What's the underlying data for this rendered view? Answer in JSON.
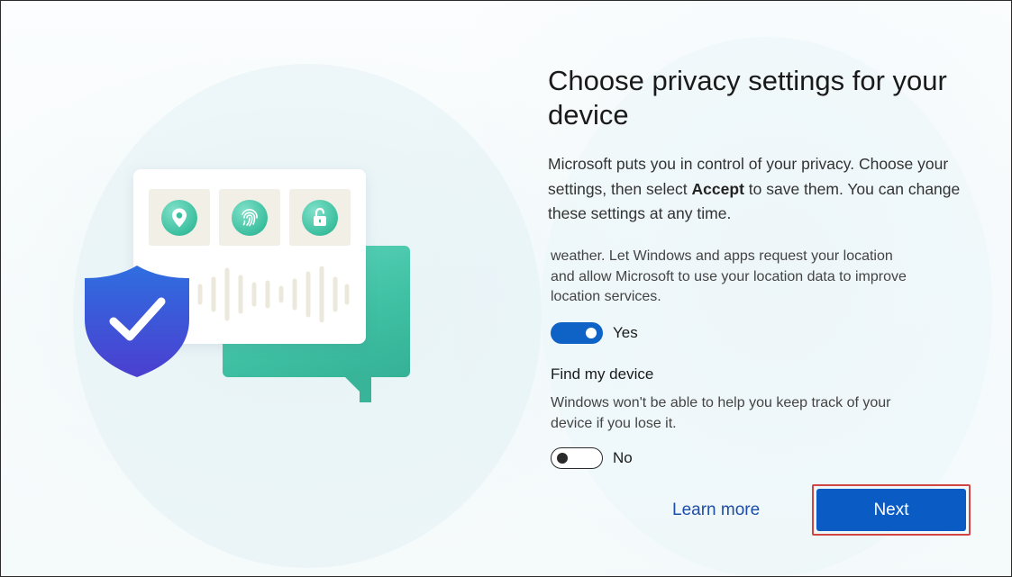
{
  "page": {
    "title": "Choose privacy settings for your device",
    "description_before": "Microsoft puts you in control of your privacy. Choose your settings, then select ",
    "description_bold": "Accept",
    "description_after": " to save them. You can change these settings at any time."
  },
  "settings": [
    {
      "title": "",
      "description": "weather. Let Windows and apps request your location and allow Microsoft to use your location data to improve location services.",
      "toggle_state": "on",
      "toggle_label": "Yes"
    },
    {
      "title": "Find my device",
      "description": "Windows won't be able to help you keep track of your device if you lose it.",
      "toggle_state": "off",
      "toggle_label": "No"
    }
  ],
  "actions": {
    "learn_more": "Learn more",
    "next": "Next"
  },
  "colors": {
    "accent": "#0a5bc4",
    "link": "#1e4fa8",
    "highlight_border": "#d24545",
    "illustration_teal": "#3fc0a3",
    "shield_blue": "#3a4fd8"
  },
  "illustration": {
    "icons": [
      "location-pin-icon",
      "fingerprint-icon",
      "unlock-icon",
      "shield-check-icon",
      "voice-wave-icon"
    ]
  }
}
